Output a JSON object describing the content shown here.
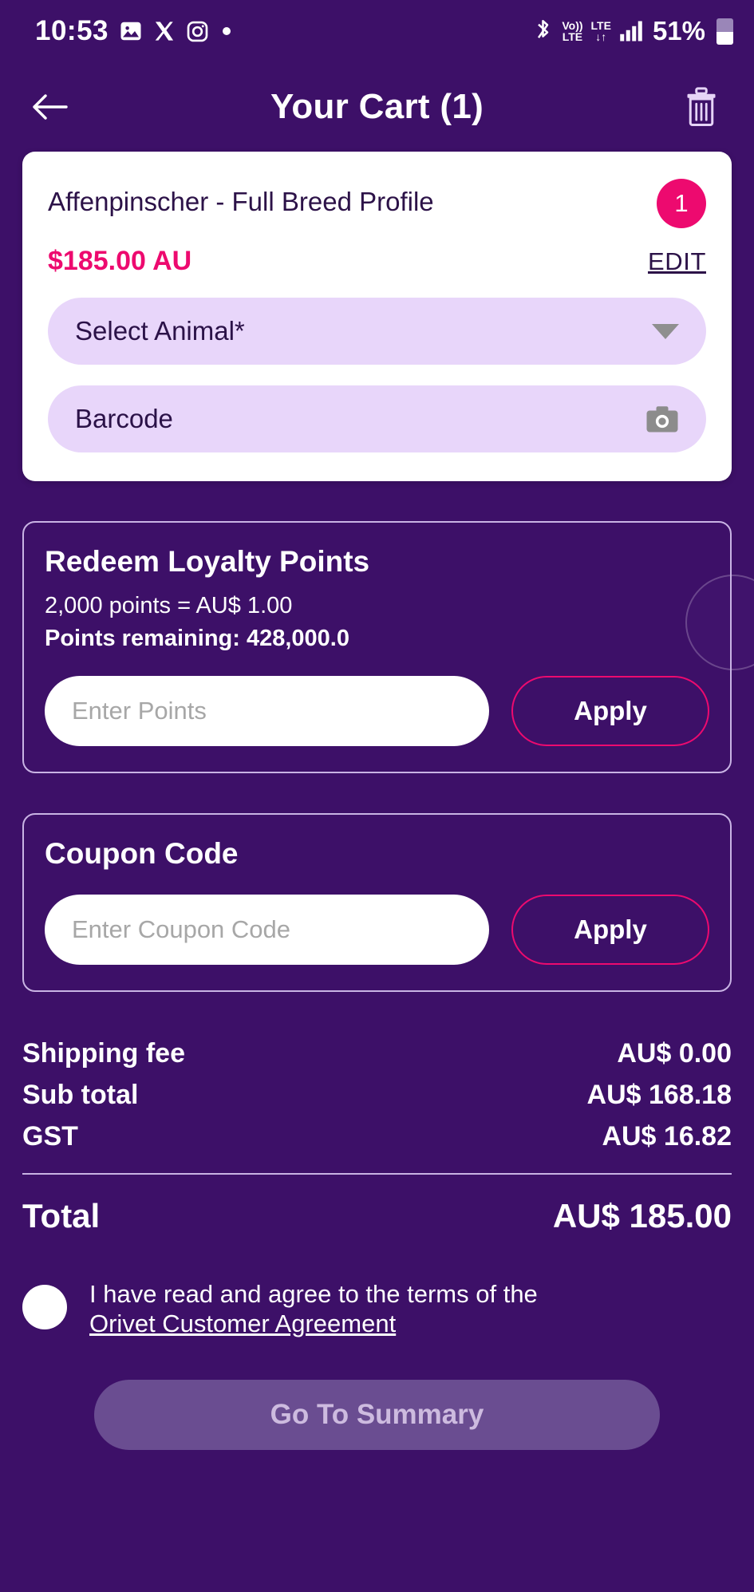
{
  "statusbar": {
    "time": "10:53",
    "icons": [
      "gallery-icon",
      "x-logo-icon",
      "instagram-icon",
      "dot-icon"
    ],
    "bluetooth": "bluetooth-icon",
    "volte_top": "Vo))",
    "volte_bottom": "LTE",
    "lte_top": "LTE",
    "lte_bottom": "↓↑",
    "signal": "signal-bars-icon",
    "battery_percent": "51%"
  },
  "appbar": {
    "back": "back-arrow-icon",
    "title": "Your Cart (1)",
    "delete": "trash-icon"
  },
  "product": {
    "name": "Affenpinscher - Full Breed Profile",
    "quantity": "1",
    "price": "$185.00 AU",
    "edit_label": "EDIT",
    "select_animal_label": "Select Animal*",
    "barcode_label": "Barcode",
    "camera_icon": "camera-icon"
  },
  "loyalty": {
    "title": "Redeem Loyalty Points",
    "rate": "2,000 points = AU$ 1.00",
    "remaining": "Points remaining: 428,000.0",
    "input_placeholder": "Enter Points",
    "input_value": "",
    "apply_label": "Apply"
  },
  "coupon": {
    "title": "Coupon Code",
    "input_placeholder": "Enter Coupon Code",
    "input_value": "",
    "apply_label": "Apply"
  },
  "totals": {
    "rows": [
      {
        "label": "Shipping fee",
        "value": "AU$ 0.00"
      },
      {
        "label": "Sub total",
        "value": "AU$ 168.18"
      },
      {
        "label": "GST",
        "value": "AU$ 16.82"
      }
    ],
    "grand_label": "Total",
    "grand_value": "AU$ 185.00"
  },
  "terms": {
    "text": "I have read and agree to the terms of the",
    "link": "Orivet Customer Agreement",
    "checked": false
  },
  "cta": {
    "label": "Go To Summary"
  },
  "colors": {
    "background": "#3d1068",
    "accent_pink": "#ed0a6f",
    "field_lavender": "#e8d6fa",
    "panel_border": "#c9b4e4",
    "cta_disabled": "#6a4d91"
  }
}
